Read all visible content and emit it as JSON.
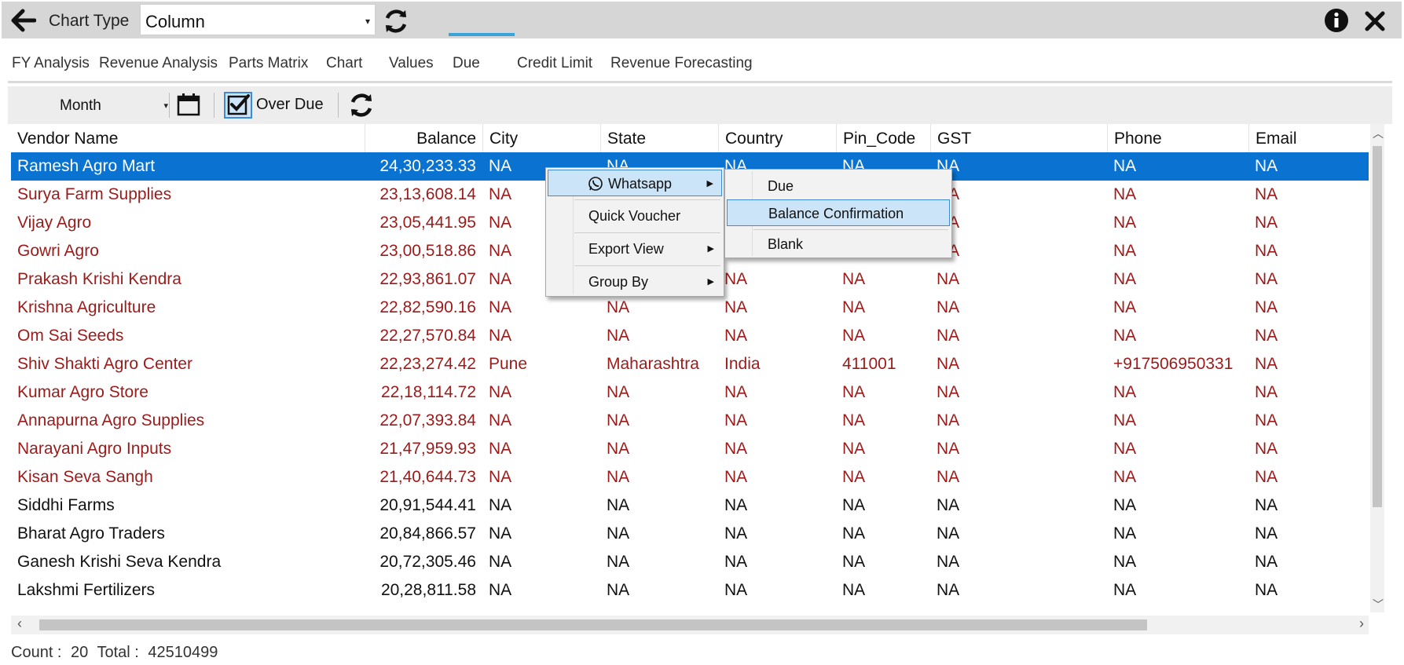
{
  "topbar": {
    "chart_type_label": "Chart Type",
    "chart_type_value": "Column"
  },
  "tabs": [
    {
      "label": "FY Analysis"
    },
    {
      "label": "Revenue Analysis"
    },
    {
      "label": "Parts Matrix"
    },
    {
      "label": "Chart"
    },
    {
      "label": "Values"
    },
    {
      "label": "Due"
    },
    {
      "label": "Credit Limit"
    },
    {
      "label": "Revenue Forecasting"
    }
  ],
  "toolbar": {
    "period_value": "Month",
    "over_due_label": "Over Due",
    "over_due_checked": true
  },
  "grid": {
    "columns": [
      "Vendor Name",
      "Balance",
      "City",
      "State",
      "Country",
      "Pin_Code",
      "GST",
      "Phone",
      "Email"
    ],
    "rows": [
      {
        "vendor": "Ramesh Agro Mart",
        "balance": "24,30,233.33",
        "city": "NA",
        "state": "NA",
        "country": "NA",
        "pin": "NA",
        "gst": "NA",
        "phone": "NA",
        "email": "NA"
      },
      {
        "vendor": "Surya Farm Supplies",
        "balance": "23,13,608.14",
        "city": "NA",
        "state": "NA",
        "country": "NA",
        "pin": "NA",
        "gst": "NA",
        "phone": "NA",
        "email": "NA"
      },
      {
        "vendor": "Vijay Agro",
        "balance": "23,05,441.95",
        "city": "NA",
        "state": "NA",
        "country": "NA",
        "pin": "NA",
        "gst": "NA",
        "phone": "NA",
        "email": "NA"
      },
      {
        "vendor": "Gowri Agro",
        "balance": "23,00,518.86",
        "city": "NA",
        "state": "NA",
        "country": "NA",
        "pin": "NA",
        "gst": "NA",
        "phone": "NA",
        "email": "NA"
      },
      {
        "vendor": "Prakash Krishi Kendra",
        "balance": "22,93,861.07",
        "city": "NA",
        "state": "NA",
        "country": "NA",
        "pin": "NA",
        "gst": "NA",
        "phone": "NA",
        "email": "NA"
      },
      {
        "vendor": "Krishna Agriculture",
        "balance": "22,82,590.16",
        "city": "NA",
        "state": "NA",
        "country": "NA",
        "pin": "NA",
        "gst": "NA",
        "phone": "NA",
        "email": "NA"
      },
      {
        "vendor": "Om Sai Seeds",
        "balance": "22,27,570.84",
        "city": "NA",
        "state": "NA",
        "country": "NA",
        "pin": "NA",
        "gst": "NA",
        "phone": "NA",
        "email": "NA"
      },
      {
        "vendor": "Shiv Shakti Agro Center",
        "balance": "22,23,274.42",
        "city": "Pune",
        "state": "Maharashtra",
        "country": "India",
        "pin": "411001",
        "gst": "NA",
        "phone": "+917506950331",
        "email": "NA"
      },
      {
        "vendor": "Kumar Agro Store",
        "balance": "22,18,114.72",
        "city": "NA",
        "state": "NA",
        "country": "NA",
        "pin": "NA",
        "gst": "NA",
        "phone": "NA",
        "email": "NA"
      },
      {
        "vendor": "Annapurna Agro Supplies",
        "balance": "22,07,393.84",
        "city": "NA",
        "state": "NA",
        "country": "NA",
        "pin": "NA",
        "gst": "NA",
        "phone": "NA",
        "email": "NA"
      },
      {
        "vendor": "Narayani Agro Inputs",
        "balance": "21,47,959.93",
        "city": "NA",
        "state": "NA",
        "country": "NA",
        "pin": "NA",
        "gst": "NA",
        "phone": "NA",
        "email": "NA"
      },
      {
        "vendor": "Kisan Seva Sangh",
        "balance": "21,40,644.73",
        "city": "NA",
        "state": "NA",
        "country": "NA",
        "pin": "NA",
        "gst": "NA",
        "phone": "NA",
        "email": "NA"
      },
      {
        "vendor": "Siddhi Farms",
        "balance": "20,91,544.41",
        "city": "NA",
        "state": "NA",
        "country": "NA",
        "pin": "NA",
        "gst": "NA",
        "phone": "NA",
        "email": "NA"
      },
      {
        "vendor": "Bharat Agro Traders",
        "balance": "20,84,866.57",
        "city": "NA",
        "state": "NA",
        "country": "NA",
        "pin": "NA",
        "gst": "NA",
        "phone": "NA",
        "email": "NA"
      },
      {
        "vendor": "Ganesh Krishi Seva Kendra",
        "balance": "20,72,305.46",
        "city": "NA",
        "state": "NA",
        "country": "NA",
        "pin": "NA",
        "gst": "NA",
        "phone": "NA",
        "email": "NA"
      },
      {
        "vendor": "Lakshmi Fertilizers",
        "balance": "20,28,811.58",
        "city": "NA",
        "state": "NA",
        "country": "NA",
        "pin": "NA",
        "gst": "NA",
        "phone": "NA",
        "email": "NA"
      }
    ]
  },
  "context_menu": {
    "items": [
      {
        "label": "Whatsapp"
      },
      {
        "label": "Quick Voucher"
      },
      {
        "label": "Export View"
      },
      {
        "label": "Group By"
      }
    ],
    "whatsapp_submenu": [
      {
        "label": "Due"
      },
      {
        "label": "Balance Confirmation"
      },
      {
        "label": "Blank"
      }
    ]
  },
  "footer": {
    "count_label": "Count :",
    "count_value": "20",
    "total_label": "Total :",
    "total_value": "42510499"
  },
  "colors": {
    "overdue_text": "#9b1b1b",
    "normal_text": "#111111",
    "selected_row": "#0a73d1",
    "tab_accent": "#3aa3d8",
    "menu_highlight": "#cce4f7"
  },
  "icons": [
    "back-arrow-icon",
    "refresh-icon",
    "info-icon",
    "close-icon",
    "calendar-icon",
    "checkbox-checked-icon",
    "whatsapp-icon",
    "chevron-right-icon"
  ]
}
